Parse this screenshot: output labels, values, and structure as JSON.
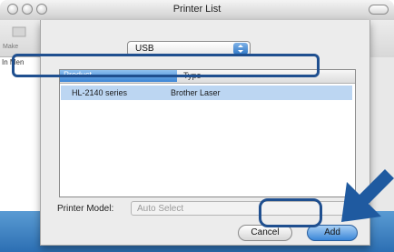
{
  "window": {
    "title": "Printer List"
  },
  "parent": {
    "make_label": "Make",
    "in_menu_label": "In Men"
  },
  "dialog": {
    "connection": {
      "selected": "USB"
    },
    "table": {
      "columns": [
        "Product",
        "Type"
      ],
      "rows": [
        {
          "product": "HL-2140 series",
          "type": "Brother Laser",
          "selected": true
        }
      ]
    },
    "printer_model": {
      "label": "Printer Model:",
      "value": "Auto Select"
    },
    "buttons": {
      "cancel": "Cancel",
      "add": "Add"
    }
  },
  "colors": {
    "selection": "#bcd6f2",
    "callout": "#1f4f8f",
    "accent_blue": "#3a86d8"
  },
  "icons": [
    "window-close-icon",
    "window-minimize-icon",
    "window-zoom-icon",
    "toolbar-pill-icon",
    "popup-arrows-icon",
    "pointer-arrow-icon"
  ]
}
